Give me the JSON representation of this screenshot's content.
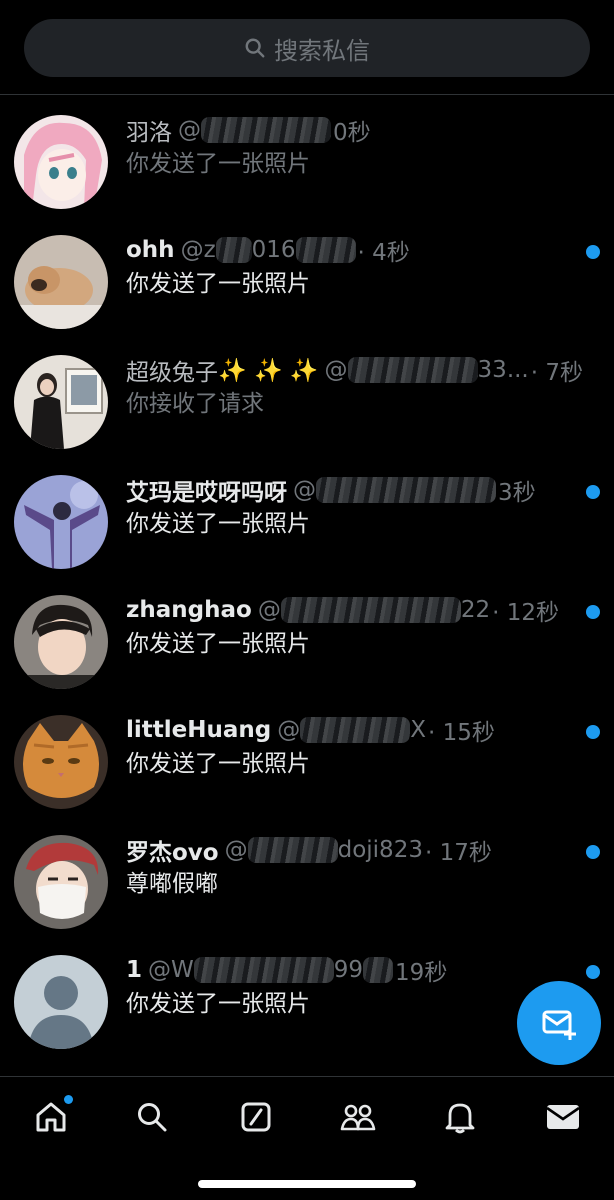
{
  "search": {
    "placeholder": "搜索私信"
  },
  "conversations": [
    {
      "name": "羽洛",
      "handle_prefix": "@",
      "time": "0秒",
      "preview": "你发送了一张照片",
      "read": true,
      "unread": false
    },
    {
      "name": "ohh",
      "handle_prefix": "@",
      "handle_visible": "z",
      "handle_mid": "016",
      "time": "· 4秒",
      "preview": "你发送了一张照片",
      "read": false,
      "unread": true
    },
    {
      "name": "超级兔子",
      "name_emoji": "✨ ✨ ✨",
      "handle_prefix": "@",
      "handle_mid": "33...",
      "time": "· 7秒",
      "preview": "你接收了请求",
      "read": true,
      "unread": false
    },
    {
      "name": "艾玛是哎呀吗呀",
      "handle_prefix": "@",
      "time": "3秒",
      "preview": "你发送了一张照片",
      "read": false,
      "unread": true
    },
    {
      "name": "zhanghao",
      "handle_prefix": "@",
      "handle_mid": "22",
      "time": "· 12秒",
      "preview": "你发送了一张照片",
      "read": false,
      "unread": true
    },
    {
      "name": "littleHuang",
      "handle_prefix": "@",
      "handle_mid": "X",
      "time": "· 15秒",
      "preview": "你发送了一张照片",
      "read": false,
      "unread": true
    },
    {
      "name": "罗杰ovo",
      "handle_prefix": "@",
      "handle_mid": "doji823",
      "time": "· 17秒",
      "preview": "尊嘟假嘟",
      "read": false,
      "unread": true
    },
    {
      "name": "1",
      "handle_prefix": "@",
      "handle_visible": "W",
      "handle_mid": "99",
      "time": "19秒",
      "preview": "你发送了一张照片",
      "read": false,
      "unread": true
    }
  ],
  "icons": {
    "search": "search-icon",
    "new_message": "new-message-icon",
    "nav": [
      "home-icon",
      "explore-search-icon",
      "grok-icon",
      "communities-icon",
      "notifications-icon",
      "messages-icon"
    ]
  },
  "colors": {
    "accent": "#1d9bf0",
    "background": "#000000",
    "muted": "#71767b"
  }
}
